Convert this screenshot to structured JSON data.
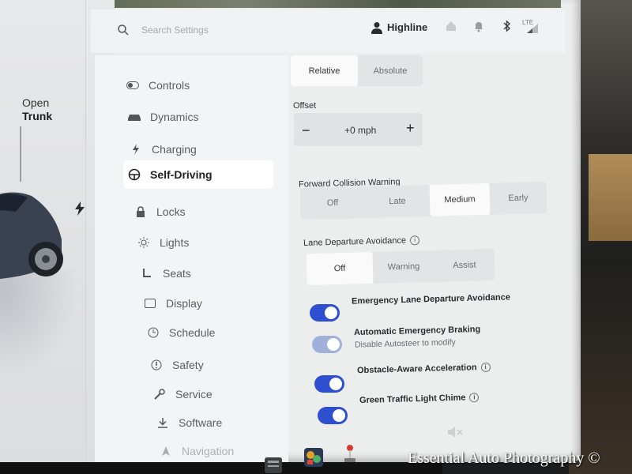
{
  "search": {
    "placeholder": "Search Settings"
  },
  "profile": {
    "name": "Highline"
  },
  "status_bar": {
    "network_label": "LTE"
  },
  "car_panel": {
    "trunk_line1": "Open",
    "trunk_line2": "Trunk"
  },
  "nav": {
    "items": [
      {
        "label": "Controls",
        "icon": "toggle-icon"
      },
      {
        "label": "Dynamics",
        "icon": "car-icon"
      },
      {
        "label": "Charging",
        "icon": "bolt-icon"
      },
      {
        "label": "Self-Driving",
        "icon": "steering-wheel-icon",
        "active": true
      },
      {
        "label": "Locks",
        "icon": "lock-icon"
      },
      {
        "label": "Lights",
        "icon": "sun-icon"
      },
      {
        "label": "Seats",
        "icon": "seat-icon"
      },
      {
        "label": "Display",
        "icon": "display-icon"
      },
      {
        "label": "Schedule",
        "icon": "clock-icon"
      },
      {
        "label": "Safety",
        "icon": "safety-icon"
      },
      {
        "label": "Service",
        "icon": "wrench-icon"
      },
      {
        "label": "Software",
        "icon": "download-icon"
      },
      {
        "label": "Navigation",
        "icon": "navigation-icon"
      }
    ]
  },
  "speed_mode": {
    "options": [
      "Relative",
      "Absolute"
    ],
    "selected": "Relative"
  },
  "offset": {
    "label": "Offset",
    "value": "+0 mph",
    "minus": "−",
    "plus": "+"
  },
  "fcw": {
    "label": "Forward Collision Warning",
    "options": [
      "Off",
      "Late",
      "Medium",
      "Early"
    ],
    "selected": "Medium"
  },
  "lda": {
    "label": "Lane Departure Avoidance",
    "options": [
      "Off",
      "Warning",
      "Assist"
    ],
    "selected": "Off"
  },
  "toggles": [
    {
      "label": "Emergency Lane Departure Avoidance",
      "on": true
    },
    {
      "label": "Automatic Emergency Braking",
      "sub": "Disable Autosteer to modify",
      "on": true,
      "disabled": true
    },
    {
      "label": "Obstacle-Aware Acceleration",
      "on": true,
      "info": true
    },
    {
      "label": "Green Traffic Light Chime",
      "on": true,
      "info": true
    }
  ],
  "watermark": "Essential Auto Photography ©",
  "colors": {
    "accent": "#2f4fd1",
    "screen_bg": "#eceded",
    "text_dark": "#1f2023"
  }
}
